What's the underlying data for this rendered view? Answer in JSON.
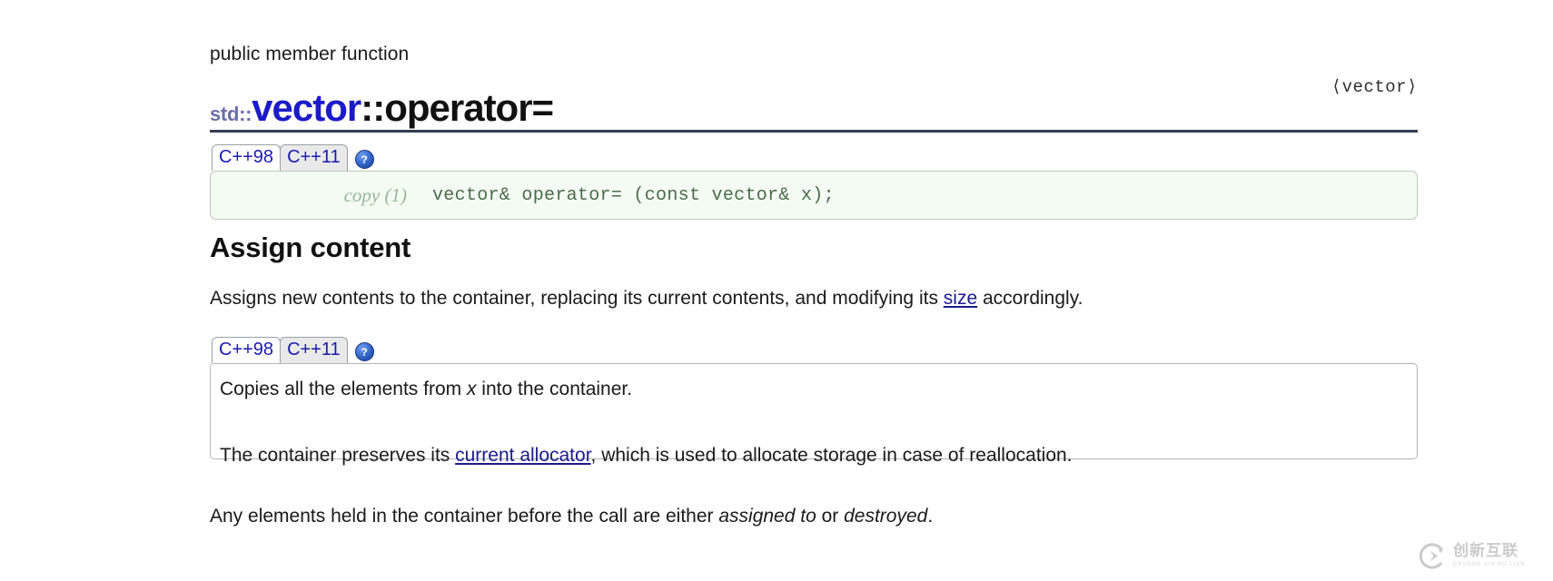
{
  "header": {
    "kicker": "public member function",
    "namespace": "std::",
    "class_name": "vector",
    "scope_separator": "::",
    "member_name": "operator=",
    "include_header": "⟨vector⟩",
    "rule_color": "#343c52",
    "class_color": "#1b1bc9",
    "namespace_color": "#6b6fa8"
  },
  "signature_panel": {
    "tabs": [
      {
        "label": "C++98",
        "active": true
      },
      {
        "label": "C++11",
        "active": false
      }
    ],
    "help_icon": "question-mark-icon",
    "help_glyph": "?",
    "overload_label": "copy (1)",
    "signature": "vector& operator= (const vector& x);",
    "panel_bg": "#f4fbf3",
    "panel_border": "#b9c9b9",
    "code_color": "#4d6b4d"
  },
  "section": {
    "heading": "Assign content",
    "intro": {
      "before_link": "Assigns new contents to the container, replacing its current contents, and modifying its ",
      "link_text": "size",
      "after_link": " accordingly."
    }
  },
  "description_panel": {
    "tabs": [
      {
        "label": "C++98",
        "active": true
      },
      {
        "label": "C++11",
        "active": false
      }
    ],
    "help_icon": "question-mark-icon",
    "help_glyph": "?",
    "line1": {
      "before_em": "Copies all the elements from ",
      "em_text": "x",
      "after_em": " into the container."
    },
    "line2": {
      "before_link": "The container preserves its ",
      "link_text": "current allocator",
      "after_link": ", which is used to allocate storage in case of reallocation."
    },
    "panel_bg": "#ffffff",
    "panel_border": "#b5b5b5"
  },
  "closing": {
    "part1": "Any elements held in the container before the call are either ",
    "em1": "assigned to",
    "part2": " or ",
    "em2": "destroyed",
    "part3": "."
  },
  "watermark": {
    "cn_text": "创新互联",
    "en_text": "CHUANG XIN HU LIAN",
    "color": "#8d8d8d"
  },
  "link_color": "#1b1b8f"
}
